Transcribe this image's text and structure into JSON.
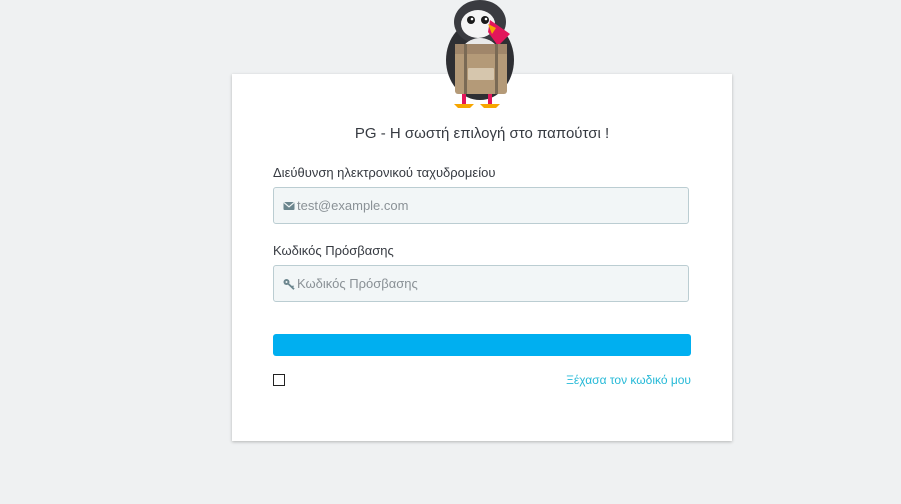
{
  "login": {
    "title": "PG - Η σωστή επιλογή στο παπούτσι !",
    "email_label": "Διεύθυνση ηλεκτρονικού ταχυδρομείου",
    "email_placeholder": "test@example.com",
    "email_value": "",
    "email_icon": "envelope-icon",
    "password_label": "Κωδικός Πρόσβασης",
    "password_placeholder": "Κωδικός Πρόσβασης",
    "password_value": "",
    "password_icon": "key-icon",
    "submit_label": "",
    "stay_logged_in_checked": false,
    "forgot_password_link": "Ξέχασα τον κωδικό μου"
  },
  "mascot": {
    "icon": "puffin-mascot-logo"
  },
  "colors": {
    "background": "#eff1f2",
    "accent": "#00aff0",
    "link": "#25b9d7",
    "input_bg": "#f2f6f7",
    "input_border": "#bbcdd2"
  }
}
